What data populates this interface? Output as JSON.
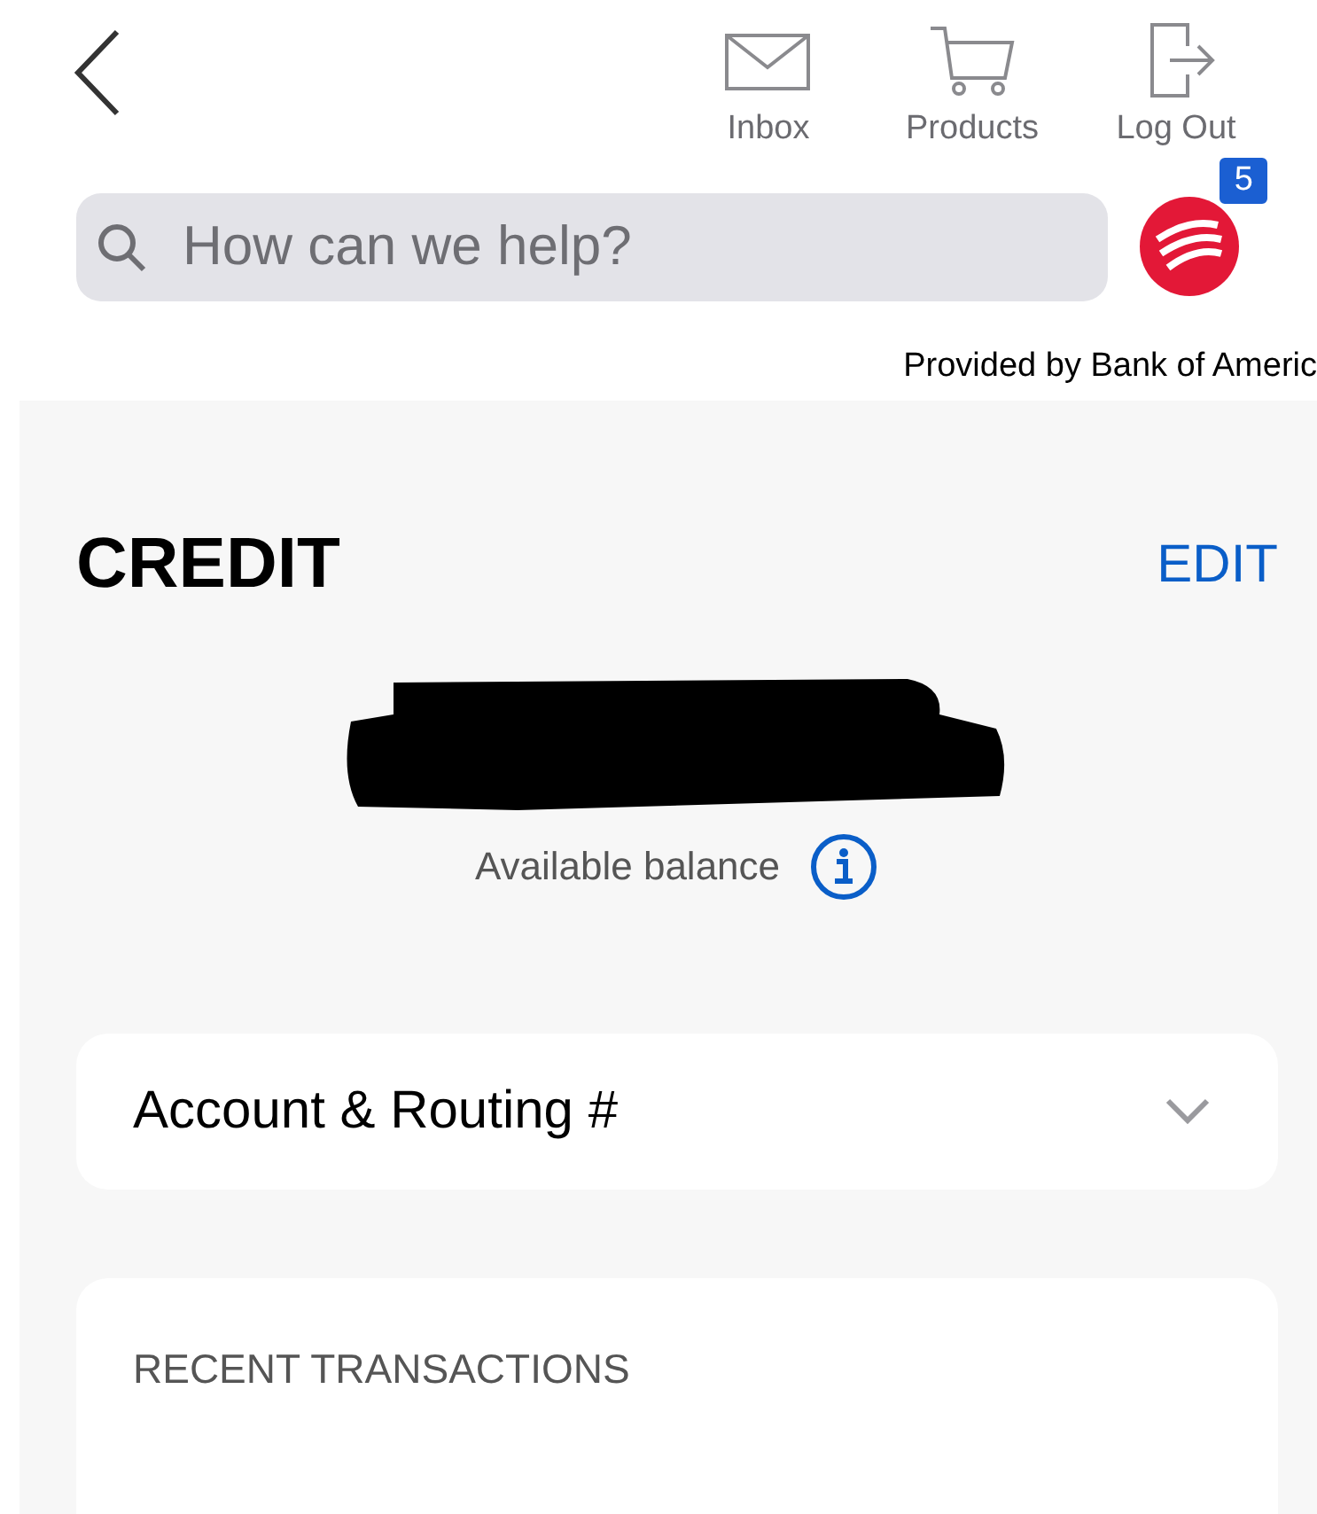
{
  "nav": {
    "items": [
      {
        "kind": "mail",
        "label": "Inbox"
      },
      {
        "kind": "cart",
        "label": "Products"
      },
      {
        "kind": "logout",
        "label": "Log Out"
      }
    ]
  },
  "search": {
    "placeholder": "How can we help?"
  },
  "notifications": {
    "count": "5"
  },
  "provider": "Provided by Bank of Americ",
  "account": {
    "title": "CREDIT",
    "edit": "EDIT",
    "balance_label": "Available balance"
  },
  "sections": [
    {
      "kind": "collapsible",
      "title": "Account & Routing #",
      "expanded": false
    },
    {
      "kind": "header",
      "title": "RECENT TRANSACTIONS"
    }
  ]
}
